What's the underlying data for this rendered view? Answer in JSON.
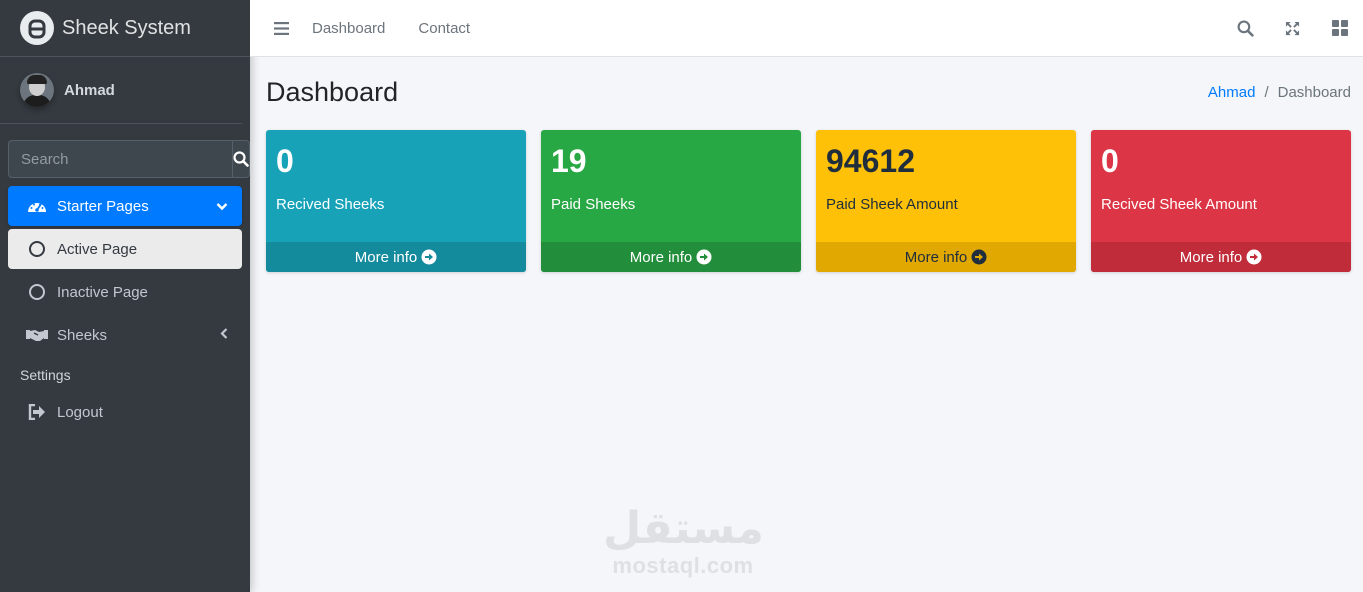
{
  "brand": {
    "name": "Sheek System"
  },
  "user": {
    "name": "Ahmad"
  },
  "search": {
    "placeholder": "Search"
  },
  "sidebar": {
    "items": [
      {
        "label": "Starter Pages",
        "icon": "tachometer-icon",
        "state": "active"
      },
      {
        "label": "Active Page",
        "icon": "circle-icon",
        "state": "sub-active"
      },
      {
        "label": "Inactive Page",
        "icon": "circle-icon",
        "state": "normal"
      },
      {
        "label": "Sheeks",
        "icon": "handshake-icon",
        "state": "normal"
      }
    ],
    "header": "Settings",
    "logout": {
      "label": "Logout",
      "icon": "sign-out-icon"
    }
  },
  "topnav": {
    "links": [
      "Dashboard",
      "Contact"
    ]
  },
  "content": {
    "title": "Dashboard",
    "breadcrumb": {
      "home": "Ahmad",
      "current": "Dashboard"
    }
  },
  "boxes": [
    {
      "value": "0",
      "label": "Recived Sheeks",
      "footer": "More info",
      "color": "#17a2b8"
    },
    {
      "value": "19",
      "label": "Paid Sheeks",
      "footer": "More info",
      "color": "#28a745"
    },
    {
      "value": "94612",
      "label": "Paid Sheek Amount",
      "footer": "More info",
      "color": "#ffc107"
    },
    {
      "value": "0",
      "label": "Recived Sheek Amount",
      "footer": "More info",
      "color": "#dc3545"
    }
  ],
  "watermark": {
    "arabic": "مستقل",
    "latin": "mostaql.com"
  }
}
